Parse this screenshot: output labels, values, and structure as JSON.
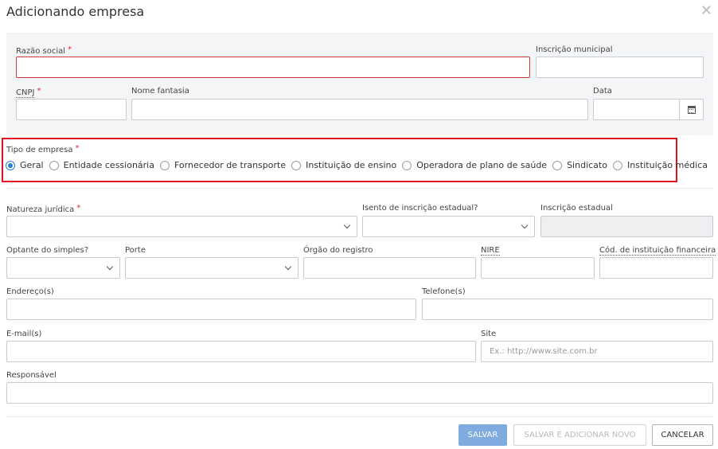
{
  "dialog": {
    "title": "Adicionando empresa"
  },
  "fields": {
    "razao_social": {
      "label": "Razão social",
      "value": ""
    },
    "inscricao_municipal": {
      "label": "Inscrição municipal",
      "value": ""
    },
    "cnpj": {
      "label": "CNPJ",
      "value": ""
    },
    "nome_fantasia": {
      "label": "Nome fantasia",
      "value": ""
    },
    "data": {
      "label": "Data",
      "value": ""
    },
    "natureza_juridica": {
      "label": "Natureza jurídica",
      "value": ""
    },
    "isento_ie": {
      "label": "Isento de inscrição estadual?",
      "value": ""
    },
    "inscricao_estadual": {
      "label": "Inscrição estadual",
      "value": ""
    },
    "optante_simples": {
      "label": "Optante do simples?",
      "value": ""
    },
    "porte": {
      "label": "Porte",
      "value": ""
    },
    "orgao_registro": {
      "label": "Órgão do registro",
      "value": ""
    },
    "nire": {
      "label": "NIRE",
      "value": ""
    },
    "cod_instituicao": {
      "label": "Cód. de instituição financeira",
      "value": ""
    },
    "enderecos": {
      "label": "Endereço(s)",
      "value": ""
    },
    "telefone": {
      "label": "Telefone(s)",
      "value": ""
    },
    "emails": {
      "label": "E-mail(s)",
      "value": ""
    },
    "site": {
      "label": "Site",
      "value": "",
      "placeholder": "Ex.: http://www.site.com.br"
    },
    "responsavel": {
      "label": "Responsável",
      "value": ""
    }
  },
  "tipo_empresa": {
    "label": "Tipo de empresa",
    "selected": "Geral",
    "options": [
      "Geral",
      "Entidade cessionária",
      "Fornecedor de transporte",
      "Instituição de ensino",
      "Operadora de plano de saúde",
      "Sindicato",
      "Instituição médica"
    ]
  },
  "required_mark": "*",
  "buttons": {
    "save": "SALVAR",
    "save_and_new": "SALVAR E ADICIONAR NOVO",
    "cancel": "CANCELAR"
  },
  "icons": {
    "close": "close-icon",
    "calendar": "calendar-icon",
    "dropdown": "chevron-down-icon"
  },
  "colors": {
    "primary": "#7fabde",
    "error": "#c9383a",
    "highlight": "#e0121f",
    "radio_active": "#2d7dd2"
  }
}
